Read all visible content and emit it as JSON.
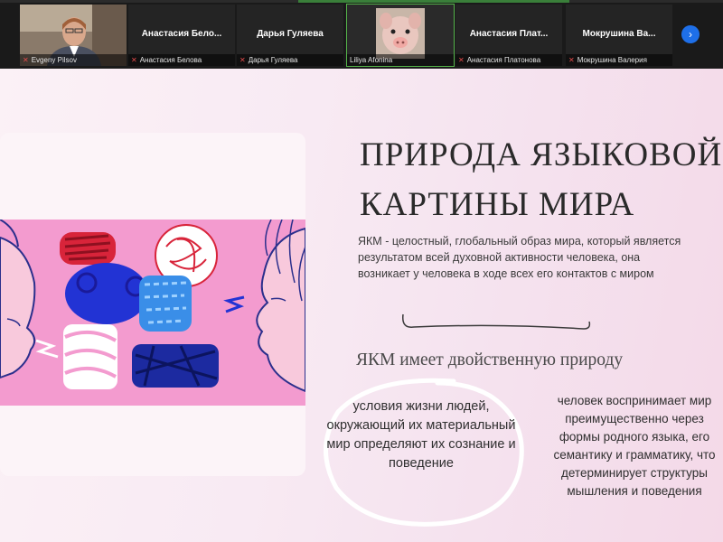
{
  "participants": [
    {
      "footer_name": "Evgeny Pilsov",
      "big_name": "",
      "type": "video"
    },
    {
      "footer_name": "Анастасия Белова",
      "big_name": "Анастасия Бело...",
      "type": "name"
    },
    {
      "footer_name": "Дарья Гуляева",
      "big_name": "Дарья Гуляева",
      "type": "name"
    },
    {
      "footer_name": "Liliya Afonina",
      "big_name": "",
      "type": "video"
    },
    {
      "footer_name": "Анастасия Платонова",
      "big_name": "Анастасия Плат...",
      "type": "name"
    },
    {
      "footer_name": "Мокрушина Валерия",
      "big_name": "Мокрушина Ва...",
      "type": "name"
    }
  ],
  "strip": {
    "next_icon": "chevron-right-icon",
    "next_glyph": "›",
    "mic_icon": "mic-muted-icon",
    "mic_glyph": "✕",
    "accent": "#1e6fe8"
  },
  "slide": {
    "title_line1": "ПРИРОДА ЯЗЫКОВОЙ",
    "title_line2": "КАРТИНЫ МИРА",
    "definition": "ЯКМ - целостный, глобальный образ мира, который является результатом всей духовной активности человека, она возникает у человека в ходе всех его контактов с миром",
    "subtitle": "ЯКМ имеет двойственную природу",
    "point1": "условия жизни людей, окружающий их материальный мир определяют их сознание и поведение",
    "point2_lines": [
      "человек воспринимает мир",
      "преимущественно через",
      "формы родного языка, его",
      "семантику и грамматику, что",
      "детерминирует структуры",
      "мышления и поведения"
    ]
  }
}
